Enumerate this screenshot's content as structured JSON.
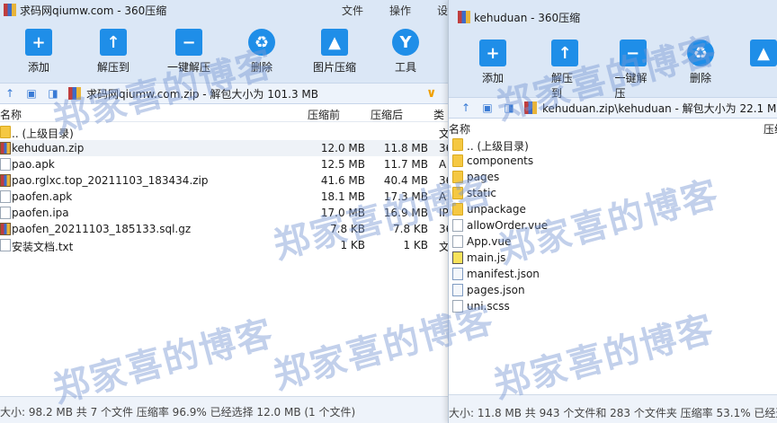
{
  "window_left": {
    "title": "求码网qiumw.com - 360压缩",
    "menu": [
      "文件",
      "操作",
      "设"
    ],
    "toolbar": [
      "添加",
      "解压到",
      "一键解压",
      "删除",
      "图片压缩",
      "工具"
    ],
    "path": "求码网qiumw.com.zip - 解包大小为 101.3 MB",
    "columns": {
      "name": "名称",
      "before": "压缩前",
      "after": "压缩后",
      "type": "类"
    },
    "rows": [
      {
        "name": ".. (上级目录)",
        "before": "",
        "after": "",
        "type": "文",
        "icon": "folder-icon"
      },
      {
        "name": "kehuduan.zip",
        "before": "12.0 MB",
        "after": "11.8 MB",
        "type": "36",
        "icon": "zip-icon"
      },
      {
        "name": "pao.apk",
        "before": "12.5 MB",
        "after": "11.7 MB",
        "type": "A",
        "icon": "apk-icon"
      },
      {
        "name": "pao.rglxc.top_20211103_183434.zip",
        "before": "41.6 MB",
        "after": "40.4 MB",
        "type": "36",
        "icon": "zip-icon"
      },
      {
        "name": "paofen.apk",
        "before": "18.1 MB",
        "after": "17.3 MB",
        "type": "A",
        "icon": "apk-icon"
      },
      {
        "name": "paofen.ipa",
        "before": "17.0 MB",
        "after": "16.9 MB",
        "type": "IP",
        "icon": "file-icon"
      },
      {
        "name": "paofen_20211103_185133.sql.gz",
        "before": "7.8 KB",
        "after": "7.8 KB",
        "type": "36",
        "icon": "zip-icon"
      },
      {
        "name": "安装文档.txt",
        "before": "1 KB",
        "after": "1 KB",
        "type": "文",
        "icon": "file-icon"
      }
    ],
    "status": "大小: 98.2 MB 共 7 个文件 压缩率 96.9% 已经选择 12.0 MB (1 个文件)"
  },
  "window_right": {
    "title": "kehuduan - 360压缩",
    "toolbar": [
      "添加",
      "解压到",
      "一键解压",
      "删除"
    ],
    "path": "kehuduan.zip\\kehuduan - 解包大小为 22.1 M",
    "columns": {
      "name": "名称",
      "before": "压缩"
    },
    "rows": [
      {
        "name": ".. (上级目录)",
        "icon": "folder-icon"
      },
      {
        "name": "components",
        "icon": "folder-icon"
      },
      {
        "name": "pages",
        "icon": "folder-icon"
      },
      {
        "name": "static",
        "icon": "folder-icon"
      },
      {
        "name": "unpackage",
        "icon": "folder-icon"
      },
      {
        "name": "allowOrder.vue",
        "icon": "file-icon"
      },
      {
        "name": "App.vue",
        "icon": "file-icon"
      },
      {
        "name": "main.js",
        "icon": "js-icon"
      },
      {
        "name": "manifest.json",
        "icon": "json-icon"
      },
      {
        "name": "pages.json",
        "icon": "json-icon"
      },
      {
        "name": "uni.scss",
        "icon": "file-icon"
      }
    ],
    "status": "大小: 11.8 MB 共 943 个文件和 283 个文件夹 压缩率 53.1% 已经选"
  },
  "watermark": "郑家喜的博客"
}
